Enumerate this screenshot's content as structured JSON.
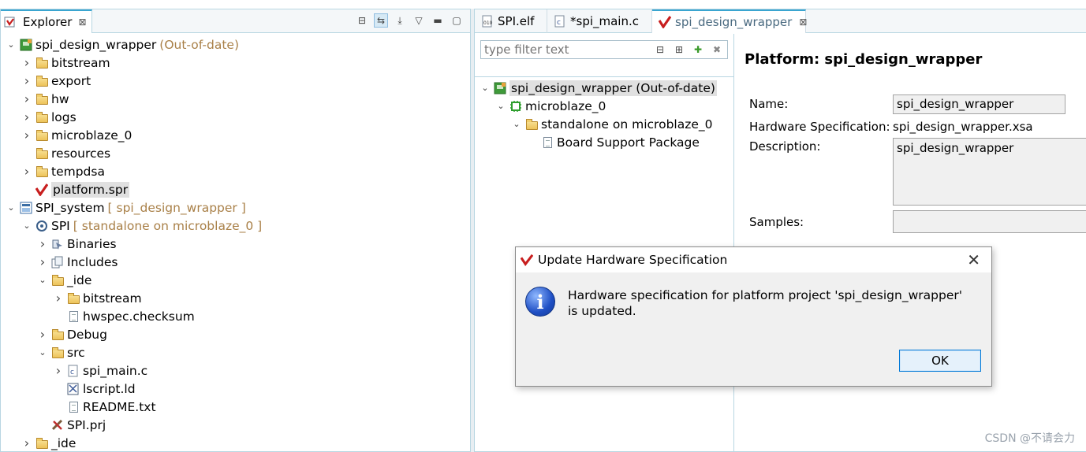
{
  "explorer": {
    "tab_label": "Explorer",
    "tree": [
      {
        "depth": 0,
        "chev": "down",
        "icon": "platform",
        "label": "spi_design_wrapper",
        "suffix": "(Out-of-date)"
      },
      {
        "depth": 1,
        "chev": "right",
        "icon": "folder",
        "label": "bitstream",
        "suffix": ""
      },
      {
        "depth": 1,
        "chev": "right",
        "icon": "folder",
        "label": "export",
        "suffix": ""
      },
      {
        "depth": 1,
        "chev": "right",
        "icon": "folder",
        "label": "hw",
        "suffix": ""
      },
      {
        "depth": 1,
        "chev": "right",
        "icon": "folder",
        "label": "logs",
        "suffix": ""
      },
      {
        "depth": 1,
        "chev": "right",
        "icon": "folder",
        "label": "microblaze_0",
        "suffix": ""
      },
      {
        "depth": 1,
        "chev": "none",
        "icon": "folder",
        "label": "resources",
        "suffix": ""
      },
      {
        "depth": 1,
        "chev": "right",
        "icon": "folder",
        "label": "tempdsa",
        "suffix": ""
      },
      {
        "depth": 1,
        "chev": "none",
        "icon": "vitis",
        "label": "platform.spr",
        "suffix": "",
        "selected": true
      },
      {
        "depth": 0,
        "chev": "down",
        "icon": "system",
        "label": "SPI_system",
        "suffix": "[ spi_design_wrapper ]"
      },
      {
        "depth": 1,
        "chev": "down",
        "icon": "app",
        "label": "SPI",
        "suffix": "[ standalone on microblaze_0 ]"
      },
      {
        "depth": 2,
        "chev": "right",
        "icon": "binaries",
        "label": "Binaries",
        "suffix": ""
      },
      {
        "depth": 2,
        "chev": "right",
        "icon": "includes",
        "label": "Includes",
        "suffix": ""
      },
      {
        "depth": 2,
        "chev": "down",
        "icon": "folder",
        "label": "_ide",
        "suffix": ""
      },
      {
        "depth": 3,
        "chev": "right",
        "icon": "folder",
        "label": "bitstream",
        "suffix": ""
      },
      {
        "depth": 3,
        "chev": "none",
        "icon": "file",
        "label": "hwspec.checksum",
        "suffix": ""
      },
      {
        "depth": 2,
        "chev": "right",
        "icon": "folder",
        "label": "Debug",
        "suffix": ""
      },
      {
        "depth": 2,
        "chev": "down",
        "icon": "folder",
        "label": "src",
        "suffix": ""
      },
      {
        "depth": 3,
        "chev": "right",
        "icon": "cfile",
        "label": "spi_main.c",
        "suffix": ""
      },
      {
        "depth": 3,
        "chev": "none",
        "icon": "ldfile",
        "label": "lscript.ld",
        "suffix": ""
      },
      {
        "depth": 3,
        "chev": "none",
        "icon": "file",
        "label": "README.txt",
        "suffix": ""
      },
      {
        "depth": 2,
        "chev": "none",
        "icon": "prj",
        "label": "SPI.prj",
        "suffix": ""
      },
      {
        "depth": 1,
        "chev": "right",
        "icon": "folder",
        "label": "_ide",
        "suffix": ""
      }
    ]
  },
  "editor": {
    "tabs": [
      {
        "label": "SPI.elf",
        "icon": "elf"
      },
      {
        "label": "*spi_main.c",
        "icon": "cfile"
      },
      {
        "label": "spi_design_wrapper",
        "icon": "vitis",
        "active": true
      }
    ],
    "filter_placeholder": "type filter text",
    "outline": [
      {
        "depth": 0,
        "chev": "down",
        "icon": "platform",
        "label": "spi_design_wrapper (Out-of-date)",
        "selected": true
      },
      {
        "depth": 1,
        "chev": "down",
        "icon": "chip",
        "label": "microblaze_0"
      },
      {
        "depth": 2,
        "chev": "down",
        "icon": "folder",
        "label": "standalone on microblaze_0"
      },
      {
        "depth": 3,
        "chev": "none",
        "icon": "file",
        "label": "Board Support Package"
      }
    ]
  },
  "platform": {
    "title": "Platform: spi_design_wrapper",
    "name_label": "Name:",
    "name_value": "spi_design_wrapper",
    "hwspec_label": "Hardware Specification:",
    "hwspec_value": "spi_design_wrapper.xsa",
    "desc_label": "Description:",
    "desc_value": "spi_design_wrapper",
    "samples_label": "Samples:",
    "samples_value": ""
  },
  "dialog": {
    "title": "Update Hardware Specification",
    "message": "Hardware specification for platform project 'spi_design_wrapper' is updated.",
    "ok_label": "OK"
  },
  "watermark": "CSDN @不请会力"
}
